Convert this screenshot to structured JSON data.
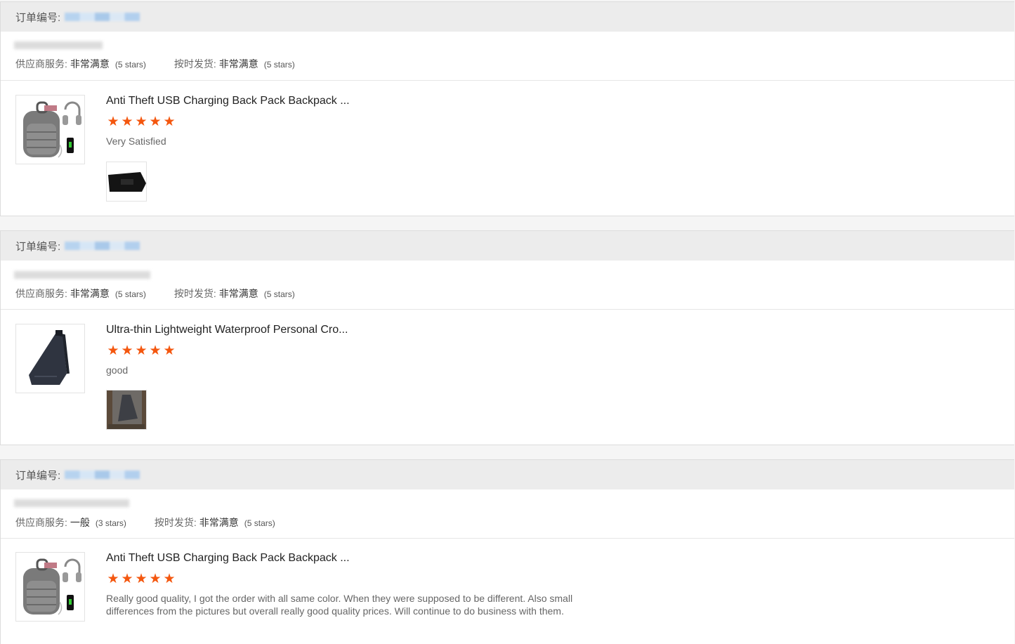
{
  "labels": {
    "order_no": "订单编号:",
    "supplier_service": "供应商服务:",
    "on_time_delivery": "按时发货:"
  },
  "orders": [
    {
      "supplier_service_value": "非常满意",
      "supplier_service_stars": "(5 stars)",
      "on_time_value": "非常满意",
      "on_time_stars": "(5 stars)",
      "product_title": "Anti Theft USB Charging Back Pack Backpack ...",
      "product_image": "backpack-gray-icon",
      "rating": 5,
      "comment": "Very Satisfied",
      "has_photo": true
    },
    {
      "supplier_service_value": "非常满意",
      "supplier_service_stars": "(5 stars)",
      "on_time_value": "非常满意",
      "on_time_stars": "(5 stars)",
      "product_title": "Ultra-thin Lightweight Waterproof Personal Cro...",
      "product_image": "sling-bag-icon",
      "rating": 5,
      "comment": "good",
      "has_photo": true
    },
    {
      "supplier_service_value": "一般",
      "supplier_service_stars": "(3 stars)",
      "on_time_value": "非常满意",
      "on_time_stars": "(5 stars)",
      "product_title": "Anti Theft USB Charging Back Pack Backpack ...",
      "product_image": "backpack-gray-icon",
      "rating": 5,
      "comment": "Really good quality, I got the order with all same color. When they were supposed to be different. Also small differences from the pictures but overall really good quality prices. Will continue to do business with them.",
      "has_photo": false
    }
  ],
  "colors": {
    "star": "#f4570f",
    "header_bg": "#ececec"
  }
}
